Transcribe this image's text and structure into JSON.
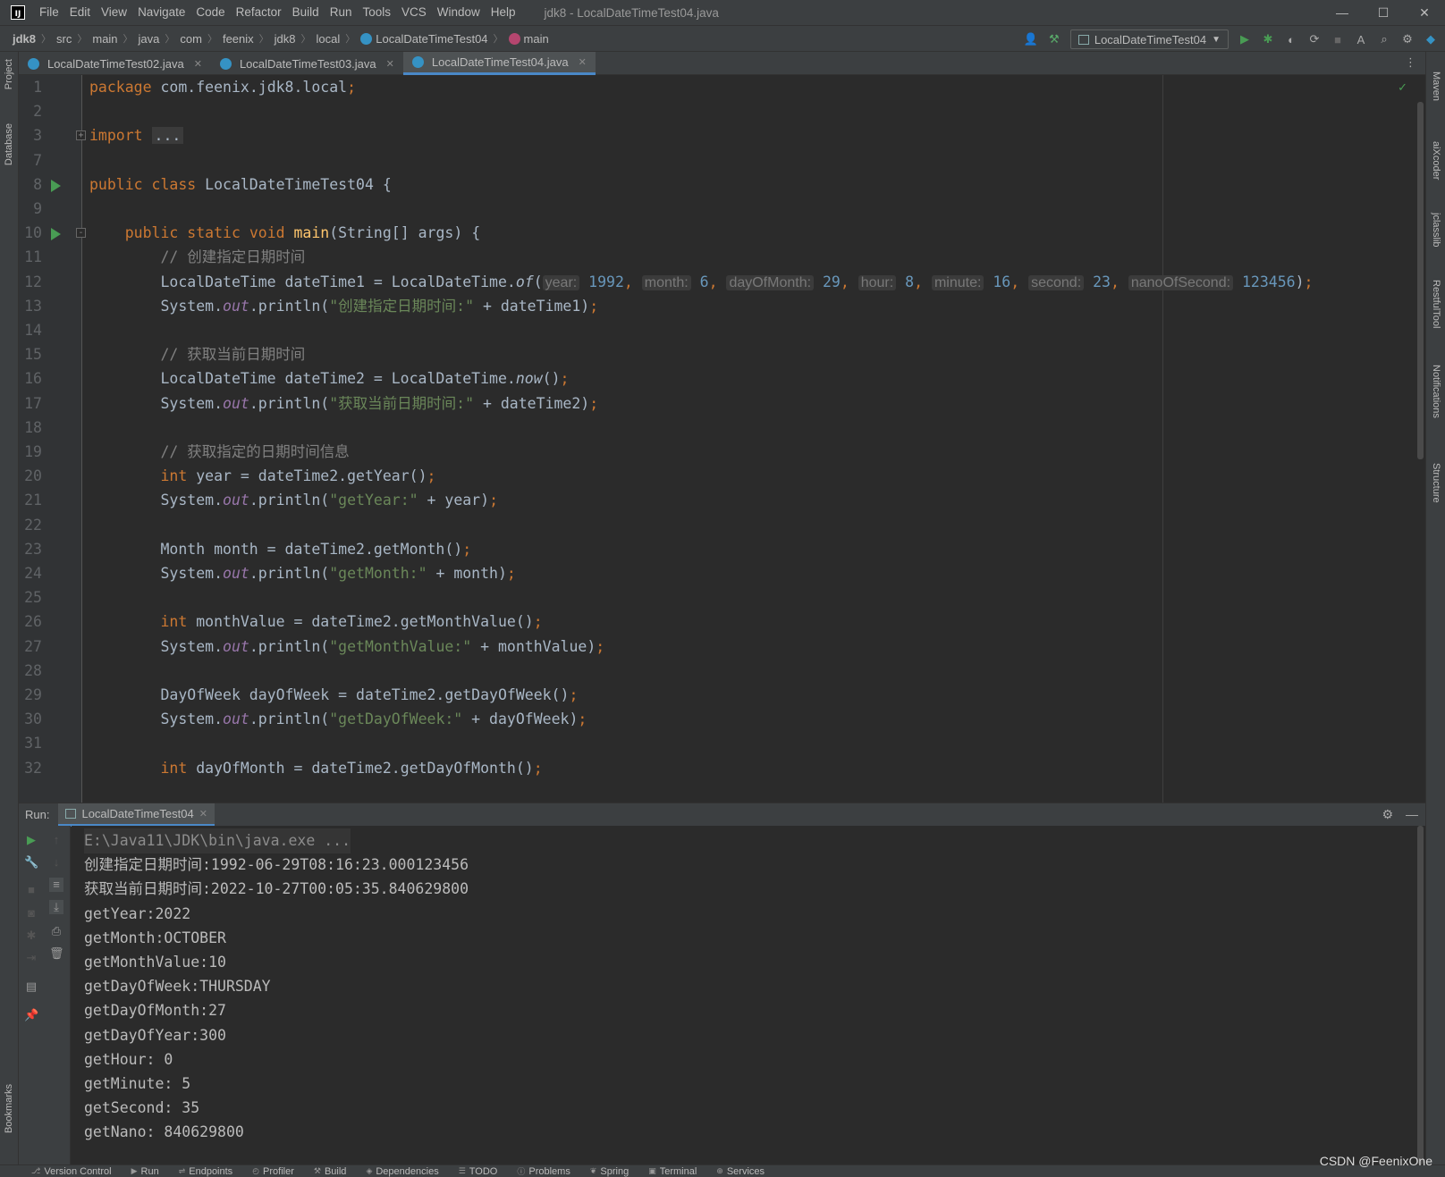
{
  "menu": {
    "items": [
      "File",
      "Edit",
      "View",
      "Navigate",
      "Code",
      "Refactor",
      "Build",
      "Run",
      "Tools",
      "VCS",
      "Window",
      "Help"
    ],
    "window_title": "jdk8 - LocalDateTimeTest04.java"
  },
  "breadcrumb": {
    "items": [
      "jdk8",
      "src",
      "main",
      "java",
      "com",
      "feenix",
      "jdk8",
      "local",
      "LocalDateTimeTest04",
      "main"
    ]
  },
  "toolbar": {
    "run_config": "LocalDateTimeTest04"
  },
  "left_stripe": {
    "project": "Project",
    "database": "Database",
    "bookmarks": "Bookmarks"
  },
  "right_stripe": {
    "maven": "Maven",
    "aixcoder": "aiXcoder",
    "jclasslib": "jclasslib",
    "restfultool": "RestfulTool",
    "notifications": "Notifications",
    "structure": "Structure"
  },
  "tabs": [
    {
      "label": "LocalDateTimeTest02.java"
    },
    {
      "label": "LocalDateTimeTest03.java"
    },
    {
      "label": "LocalDateTimeTest04.java"
    }
  ],
  "editor": {
    "lines": [
      {
        "n": "1",
        "parts": [
          [
            "kw",
            "package "
          ],
          [
            "",
            "com.feenix.jdk8.local"
          ],
          [
            "kw",
            ";"
          ]
        ]
      },
      {
        "n": "2",
        "parts": []
      },
      {
        "n": "3",
        "parts": [
          [
            "kw",
            "import "
          ],
          [
            "dots",
            "..."
          ]
        ]
      },
      {
        "n": "7",
        "parts": []
      },
      {
        "n": "8",
        "parts": [
          [
            "kw",
            "public class "
          ],
          [
            "",
            "LocalDateTimeTest04 {"
          ]
        ]
      },
      {
        "n": "9",
        "parts": []
      },
      {
        "n": "10",
        "parts": [
          [
            "",
            "    "
          ],
          [
            "kw",
            "public static void "
          ],
          [
            "mth",
            "main"
          ],
          [
            "",
            "(String[] args) {"
          ]
        ]
      },
      {
        "n": "11",
        "parts": [
          [
            "",
            "        "
          ],
          [
            "cm",
            "// 创建指定日期时间"
          ]
        ]
      },
      {
        "n": "12",
        "parts": [
          [
            "",
            "        LocalDateTime dateTime1 = LocalDateTime."
          ],
          [
            "it",
            "of"
          ],
          [
            "",
            "("
          ],
          [
            "hint",
            "year:"
          ],
          [
            "num",
            " 1992"
          ],
          [
            "kw",
            ", "
          ],
          [
            "hint",
            "month:"
          ],
          [
            "num",
            " 6"
          ],
          [
            "kw",
            ", "
          ],
          [
            "hint",
            "dayOfMonth:"
          ],
          [
            "num",
            " 29"
          ],
          [
            "kw",
            ", "
          ],
          [
            "hint",
            "hour:"
          ],
          [
            "num",
            " 8"
          ],
          [
            "kw",
            ", "
          ],
          [
            "hint",
            "minute:"
          ],
          [
            "num",
            " 16"
          ],
          [
            "kw",
            ", "
          ],
          [
            "hint",
            "second:"
          ],
          [
            "num",
            " 23"
          ],
          [
            "kw",
            ", "
          ],
          [
            "hint",
            "nanoOfSecond:"
          ],
          [
            "num",
            " 123456"
          ],
          [
            "",
            ")"
          ],
          [
            "kw",
            ";"
          ]
        ]
      },
      {
        "n": "13",
        "parts": [
          [
            "",
            "        System."
          ],
          [
            "fld",
            "out"
          ],
          [
            "",
            ".println("
          ],
          [
            "str",
            "\"创建指定日期时间:\""
          ],
          [
            "",
            " + dateTime1)"
          ],
          [
            "kw",
            ";"
          ]
        ]
      },
      {
        "n": "14",
        "parts": []
      },
      {
        "n": "15",
        "parts": [
          [
            "",
            "        "
          ],
          [
            "cm",
            "// 获取当前日期时间"
          ]
        ]
      },
      {
        "n": "16",
        "parts": [
          [
            "",
            "        LocalDateTime dateTime2 = LocalDateTime."
          ],
          [
            "it",
            "now"
          ],
          [
            "",
            "()"
          ],
          [
            "kw",
            ";"
          ]
        ]
      },
      {
        "n": "17",
        "parts": [
          [
            "",
            "        System."
          ],
          [
            "fld",
            "out"
          ],
          [
            "",
            ".println("
          ],
          [
            "str",
            "\"获取当前日期时间:\""
          ],
          [
            "",
            " + dateTime2)"
          ],
          [
            "kw",
            ";"
          ]
        ]
      },
      {
        "n": "18",
        "parts": []
      },
      {
        "n": "19",
        "parts": [
          [
            "",
            "        "
          ],
          [
            "cm",
            "// 获取指定的日期时间信息"
          ]
        ]
      },
      {
        "n": "20",
        "parts": [
          [
            "",
            "        "
          ],
          [
            "kw",
            "int "
          ],
          [
            "",
            "year = dateTime2.getYear()"
          ],
          [
            "kw",
            ";"
          ]
        ]
      },
      {
        "n": "21",
        "parts": [
          [
            "",
            "        System."
          ],
          [
            "fld",
            "out"
          ],
          [
            "",
            ".println("
          ],
          [
            "str",
            "\"getYear:\""
          ],
          [
            "",
            " + year)"
          ],
          [
            "kw",
            ";"
          ]
        ]
      },
      {
        "n": "22",
        "parts": []
      },
      {
        "n": "23",
        "parts": [
          [
            "",
            "        Month month = dateTime2.getMonth()"
          ],
          [
            "kw",
            ";"
          ]
        ]
      },
      {
        "n": "24",
        "parts": [
          [
            "",
            "        System."
          ],
          [
            "fld",
            "out"
          ],
          [
            "",
            ".println("
          ],
          [
            "str",
            "\"getMonth:\""
          ],
          [
            "",
            " + month)"
          ],
          [
            "kw",
            ";"
          ]
        ]
      },
      {
        "n": "25",
        "parts": []
      },
      {
        "n": "26",
        "parts": [
          [
            "",
            "        "
          ],
          [
            "kw",
            "int "
          ],
          [
            "",
            "monthValue = dateTime2.getMonthValue()"
          ],
          [
            "kw",
            ";"
          ]
        ]
      },
      {
        "n": "27",
        "parts": [
          [
            "",
            "        System."
          ],
          [
            "fld",
            "out"
          ],
          [
            "",
            ".println("
          ],
          [
            "str",
            "\"getMonthValue:\""
          ],
          [
            "",
            " + monthValue)"
          ],
          [
            "kw",
            ";"
          ]
        ]
      },
      {
        "n": "28",
        "parts": []
      },
      {
        "n": "29",
        "parts": [
          [
            "",
            "        DayOfWeek dayOfWeek = dateTime2.getDayOfWeek()"
          ],
          [
            "kw",
            ";"
          ]
        ]
      },
      {
        "n": "30",
        "parts": [
          [
            "",
            "        System."
          ],
          [
            "fld",
            "out"
          ],
          [
            "",
            ".println("
          ],
          [
            "str",
            "\"getDayOfWeek:\""
          ],
          [
            "",
            " + dayOfWeek)"
          ],
          [
            "kw",
            ";"
          ]
        ]
      },
      {
        "n": "31",
        "parts": []
      },
      {
        "n": "32",
        "parts": [
          [
            "",
            "        "
          ],
          [
            "kw",
            "int "
          ],
          [
            "",
            "dayOfMonth = dateTime2.getDayOfMonth()"
          ],
          [
            "kw",
            ";"
          ]
        ]
      }
    ]
  },
  "run_panel": {
    "label": "Run:",
    "tab": "LocalDateTimeTest04",
    "output": [
      "E:\\Java11\\JDK\\bin\\java.exe ...",
      "创建指定日期时间:1992-06-29T08:16:23.000123456",
      "获取当前日期时间:2022-10-27T00:05:35.840629800",
      "getYear:2022",
      "getMonth:OCTOBER",
      "getMonthValue:10",
      "getDayOfWeek:THURSDAY",
      "getDayOfMonth:27",
      "getDayOfYear:300",
      "getHour: 0",
      "getMinute: 5",
      "getSecond: 35",
      "getNano: 840629800"
    ]
  },
  "statusbar": {
    "items": [
      "Version Control",
      "Run",
      "Endpoints",
      "Profiler",
      "Build",
      "Dependencies",
      "TODO",
      "Problems",
      "Spring",
      "Terminal",
      "Services"
    ],
    "watermark": "CSDN @FeenixOne"
  }
}
